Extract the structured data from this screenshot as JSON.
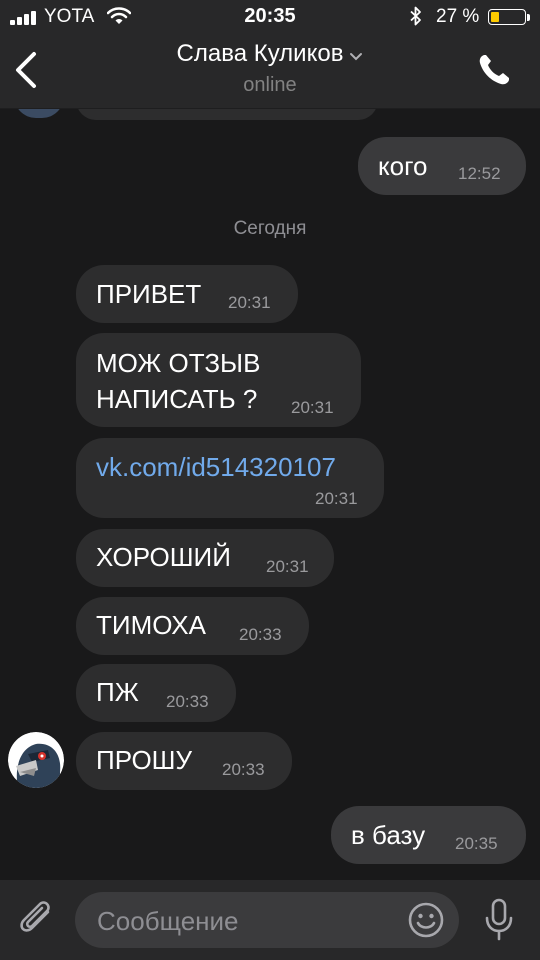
{
  "status_bar": {
    "carrier": "YOTA",
    "time": "20:35",
    "battery_percent": "27 %",
    "battery_level": 0.27,
    "icons": [
      "signal-icon",
      "wifi-icon",
      "bluetooth-icon",
      "battery-icon"
    ]
  },
  "header": {
    "title": "Слава Куликов",
    "status": "online",
    "icons": [
      "back-arrow-icon",
      "chevron-down-icon",
      "phone-icon"
    ]
  },
  "chat": {
    "day_separator": "Сегодня",
    "messages": [
      {
        "direction": "out",
        "text": "кого",
        "time": "12:52"
      },
      {
        "direction": "in",
        "text": "ПРИВЕТ",
        "time": "20:31"
      },
      {
        "direction": "in",
        "lines": [
          "МОЖ ОТЗЫВ",
          "НАПИСАТЬ ?"
        ],
        "time": "20:31"
      },
      {
        "direction": "in",
        "text": "vk.com/id514320107",
        "time": "20:31",
        "is_link": true
      },
      {
        "direction": "in",
        "text": "ХОРОШИЙ",
        "time": "20:31"
      },
      {
        "direction": "in",
        "text": "ТИМОХА",
        "time": "20:33"
      },
      {
        "direction": "in",
        "text": "ПЖ",
        "time": "20:33"
      },
      {
        "direction": "in",
        "text": "ПРОШУ",
        "time": "20:33"
      },
      {
        "direction": "out",
        "text": "в базу",
        "time": "20:35"
      }
    ]
  },
  "composer": {
    "placeholder": "Сообщение",
    "value": "",
    "icons": [
      "paperclip-icon",
      "smiley-icon",
      "microphone-icon"
    ]
  },
  "colors": {
    "background": "#19191a",
    "bar": "#282829",
    "incoming_bubble": "#2d2d2e",
    "outgoing_bubble": "#3a3a3c",
    "link": "#71aaeb",
    "battery_fill": "#ffcc00"
  }
}
